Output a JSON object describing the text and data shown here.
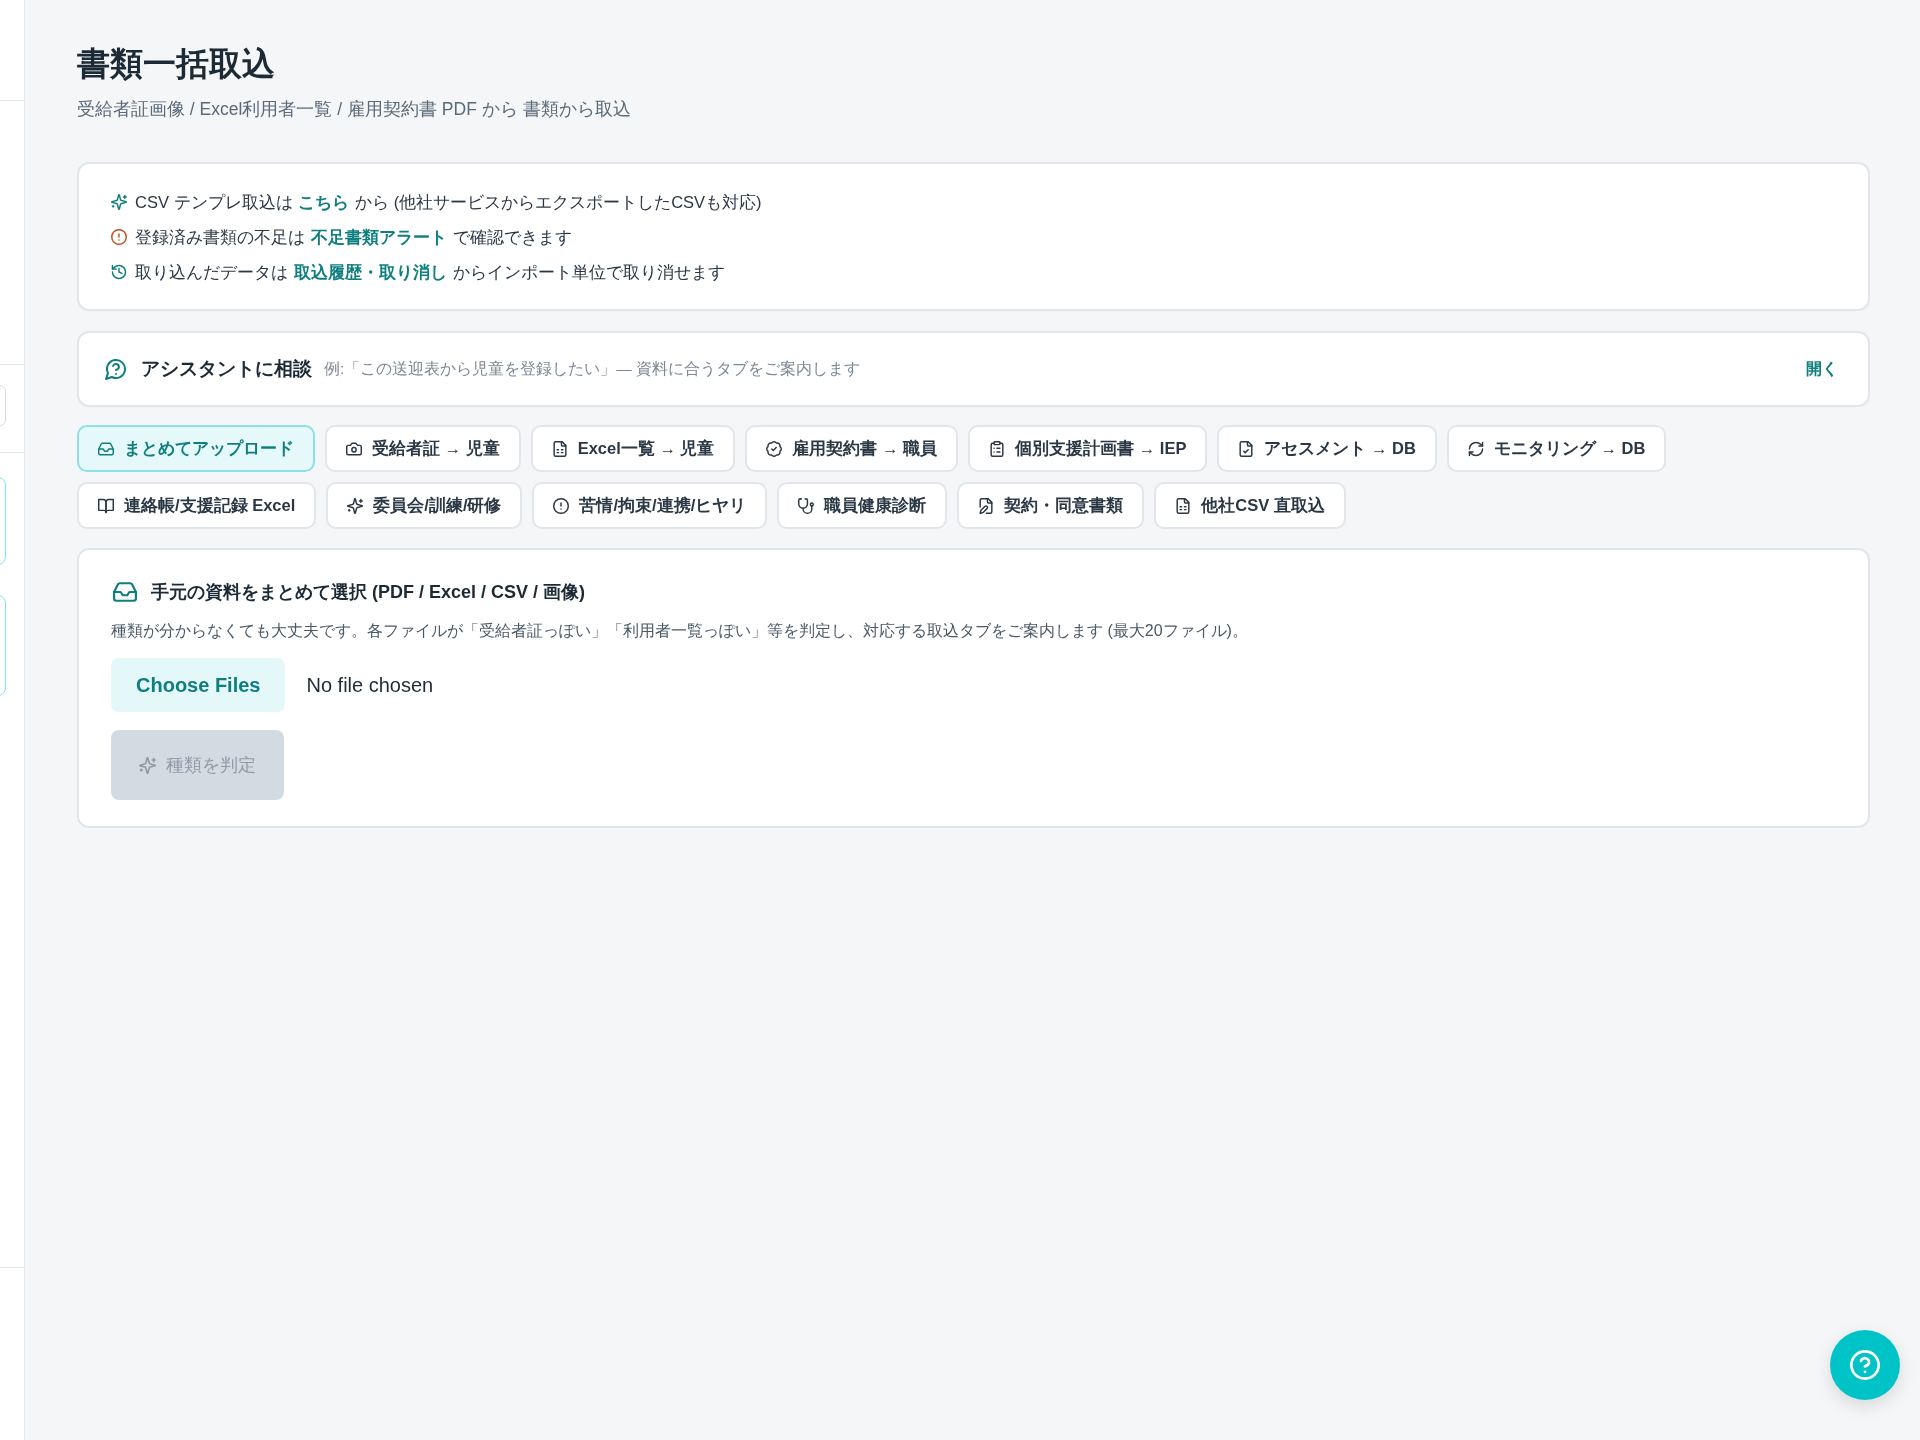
{
  "page": {
    "title": "書類一括取込",
    "subtitle": "受給者証画像 / Excel利用者一覧 / 雇用契約書 PDF から 書類から取込"
  },
  "notices": [
    {
      "before": "CSV テンプレ取込は",
      "link": "こちら",
      "after": "から (他社サービスからエクスポートしたCSVも対応)"
    },
    {
      "before": "登録済み書類の不足は",
      "link": "不足書類アラート",
      "after": "で確認できます"
    },
    {
      "before": "取り込んだデータは",
      "link": "取込履歴・取り消し",
      "after": "からインポート単位で取り消せます"
    }
  ],
  "assistant": {
    "title": "アシスタントに相談",
    "hint": "例:「この送迎表から児童を登録したい」— 資料に合うタブをご案内します",
    "open_label": "開く"
  },
  "tabs": [
    {
      "label": "まとめてアップロード",
      "selected": true
    },
    {
      "label": "受給者証 → 児童",
      "selected": false
    },
    {
      "label": "Excel一覧 → 児童",
      "selected": false
    },
    {
      "label": "雇用契約書 → 職員",
      "selected": false
    },
    {
      "label": "個別支援計画書 → IEP",
      "selected": false
    },
    {
      "label": "アセスメント → DB",
      "selected": false
    },
    {
      "label": "モニタリング → DB",
      "selected": false
    },
    {
      "label": "連絡帳/支援記録 Excel",
      "selected": false
    },
    {
      "label": "委員会/訓練/研修",
      "selected": false
    },
    {
      "label": "苦情/拘束/連携/ヒヤリ",
      "selected": false
    },
    {
      "label": "職員健康診断",
      "selected": false
    },
    {
      "label": "契約・同意書類",
      "selected": false
    },
    {
      "label": "他社CSV 直取込",
      "selected": false
    }
  ],
  "upload": {
    "title": "手元の資料をまとめて選択 (PDF / Excel / CSV / 画像)",
    "description": "種類が分からなくても大丈夫です。各ファイルが「受給者証っぽい」「利用者一覧っぽい」等を判定し、対応する取込タブをご案内します (最大20ファイル)。",
    "file_button": "Choose Files",
    "file_status": "No file chosen",
    "detect_button": {
      "label": "種類を判定",
      "disabled": true
    }
  }
}
